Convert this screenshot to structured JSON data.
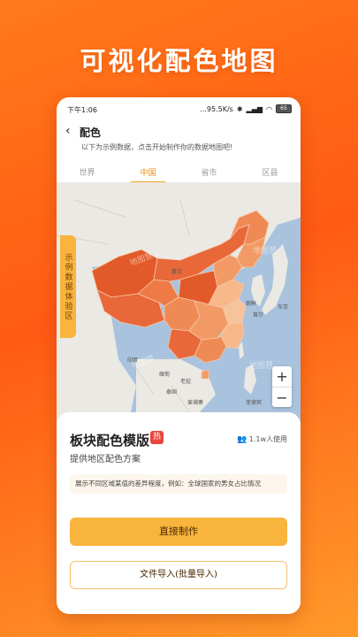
{
  "hero": {
    "title": "可视化配色地图"
  },
  "statusbar": {
    "time": "下午1:06",
    "network": "...95.5K/s",
    "battery": "65"
  },
  "nav": {
    "title": "配色",
    "subtitle": "以下为示例数据，点击开始制作你的数据地图吧!"
  },
  "tabs": [
    {
      "label": "世界",
      "active": false
    },
    {
      "label": "中国",
      "active": true
    },
    {
      "label": "省市",
      "active": false
    },
    {
      "label": "区县",
      "active": false
    }
  ],
  "map": {
    "side_tab": "示例数据体验区",
    "labels": {
      "mongolia": "蒙古",
      "korea": "朝鲜",
      "seoul": "首尔",
      "tokyo": "东京",
      "india": "印度",
      "myanmar": "缅甸",
      "laos": "老挝",
      "thailand": "泰国",
      "cambodia": "柬埔寨",
      "philippines": "菲律宾",
      "watermark": "地图慧"
    },
    "zoom_in": "+",
    "zoom_out": "−",
    "colors": {
      "water": "#a9c2de",
      "land": "#ebe9e3",
      "dark": "#e35a2a",
      "mid": "#f08a55",
      "light": "#f8b88a"
    }
  },
  "card": {
    "title": "板块配色模版",
    "hot": "热",
    "usage": "1.1w人使用",
    "subtitle": "提供地区配色方案",
    "description": "展示不同区域某值的差异程度，例如：全球国家的男女占比情况",
    "primary_button": "直接制作",
    "secondary_button": "文件导入(批量导入)"
  }
}
